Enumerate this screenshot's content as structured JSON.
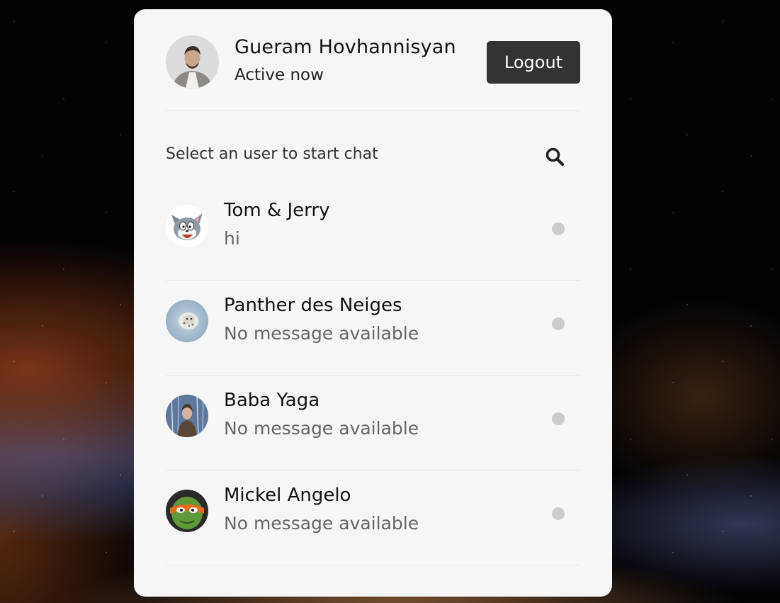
{
  "current_user": {
    "name": "Gueram Hovhannisyan",
    "status": "Active now"
  },
  "header": {
    "logout_label": "Logout"
  },
  "search": {
    "prompt": "Select an user to start chat",
    "icon": "search-icon"
  },
  "users": [
    {
      "name": "Tom & Jerry",
      "last_message": "hi",
      "status_color": "#cccccc"
    },
    {
      "name": "Panther des Neiges",
      "last_message": "No message available",
      "status_color": "#cccccc"
    },
    {
      "name": "Baba Yaga",
      "last_message": "No message available",
      "status_color": "#cccccc"
    },
    {
      "name": "Mickel Angelo",
      "last_message": "No message available",
      "status_color": "#cccccc"
    }
  ],
  "colors": {
    "card_bg": "#f6f6f6",
    "button_bg": "#333333",
    "offline_dot": "#cccccc"
  }
}
